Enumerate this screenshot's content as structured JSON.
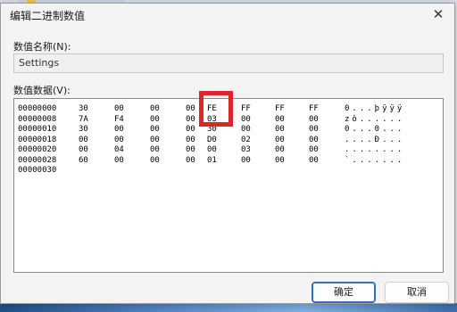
{
  "dialog": {
    "title": "编辑二进制数值",
    "name_label": "数值名称(N):",
    "name_value": "Settings",
    "data_label": "数值数据(V):",
    "ok_label": "确定",
    "cancel_label": "取消",
    "close_glyph": "✕"
  },
  "hex_rows": [
    {
      "addr": "00000000",
      "bytes": [
        "30",
        "00",
        "00",
        "00",
        "FE",
        "FF",
        "FF",
        "FF"
      ],
      "ascii": "0...þÿÿÿ"
    },
    {
      "addr": "00000008",
      "bytes": [
        "7A",
        "F4",
        "00",
        "00",
        "03",
        "00",
        "00",
        "00"
      ],
      "ascii": "zô......"
    },
    {
      "addr": "00000010",
      "bytes": [
        "30",
        "00",
        "00",
        "00",
        "30",
        "00",
        "00",
        "00"
      ],
      "ascii": "0...0..."
    },
    {
      "addr": "00000018",
      "bytes": [
        "00",
        "00",
        "00",
        "00",
        "D0",
        "02",
        "00",
        "00"
      ],
      "ascii": "....Ð..."
    },
    {
      "addr": "00000020",
      "bytes": [
        "00",
        "04",
        "00",
        "00",
        "00",
        "03",
        "00",
        "00"
      ],
      "ascii": "........"
    },
    {
      "addr": "00000028",
      "bytes": [
        "60",
        "00",
        "00",
        "00",
        "01",
        "00",
        "00",
        "00"
      ],
      "ascii": "`......."
    },
    {
      "addr": "00000030",
      "bytes": [],
      "ascii": ""
    }
  ],
  "colors": {
    "highlight": "#e0252a",
    "accent": "#2f6fc1"
  }
}
